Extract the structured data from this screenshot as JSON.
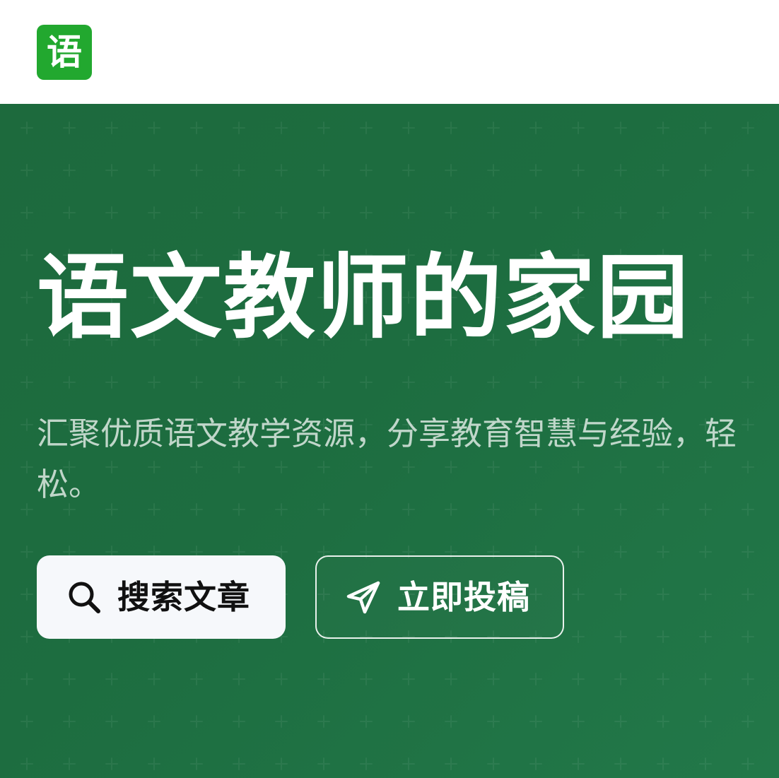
{
  "app": {
    "logo_text": "语"
  },
  "hero": {
    "title": "语文教师的家园",
    "subtitle": "汇聚优质语文教学资源，分享教育智慧与经验，轻松。"
  },
  "actions": {
    "search_label": "搜索文章",
    "submit_label": "立即投稿"
  },
  "icons": {
    "search": "search-icon",
    "submit": "paper-plane-icon"
  },
  "colors": {
    "brand": "#22a82f",
    "hero_background": "#1d6a3d",
    "button_light": "#f6f8fb",
    "text_light": "#ffffff"
  }
}
